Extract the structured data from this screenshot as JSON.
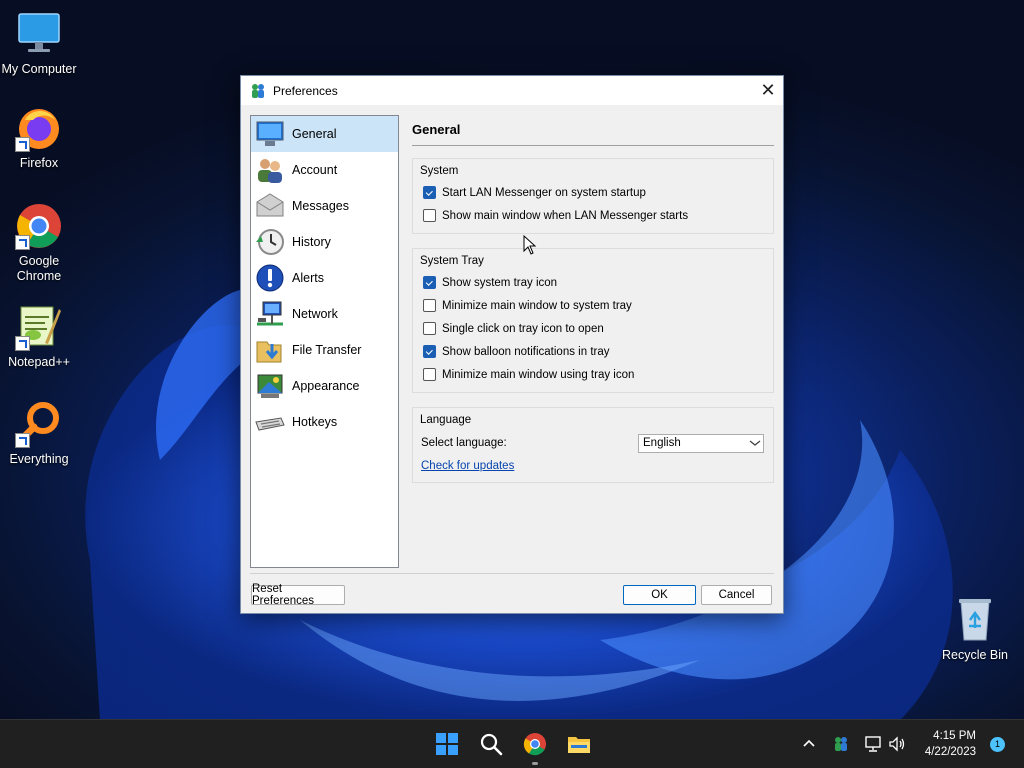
{
  "desktop": {
    "icons": [
      {
        "label": "My Computer",
        "icon": "monitor-icon"
      },
      {
        "label": "Firefox",
        "icon": "firefox-icon"
      },
      {
        "label": "Google Chrome",
        "icon": "chrome-icon"
      },
      {
        "label": "Notepad++",
        "icon": "notepadpp-icon"
      },
      {
        "label": "Everything",
        "icon": "search-magnifier-icon"
      },
      {
        "label": "Recycle Bin",
        "icon": "recycle-bin-icon"
      }
    ]
  },
  "dialog": {
    "title": "Preferences",
    "close_glyph": "✕",
    "nav": [
      {
        "label": "General",
        "icon": "monitor-icon",
        "selected": true
      },
      {
        "label": "Account",
        "icon": "users-icon"
      },
      {
        "label": "Messages",
        "icon": "envelope-icon"
      },
      {
        "label": "History",
        "icon": "clock-icon"
      },
      {
        "label": "Alerts",
        "icon": "exclamation-icon"
      },
      {
        "label": "Network",
        "icon": "network-icon"
      },
      {
        "label": "File Transfer",
        "icon": "folder-download-icon"
      },
      {
        "label": "Appearance",
        "icon": "palette-icon"
      },
      {
        "label": "Hotkeys",
        "icon": "keyboard-icon"
      }
    ],
    "panel_title": "General",
    "system": {
      "title": "System",
      "options": [
        {
          "label": "Start LAN Messenger on system startup",
          "checked": true
        },
        {
          "label": "Show main window when LAN Messenger starts",
          "checked": false
        }
      ]
    },
    "tray": {
      "title": "System Tray",
      "options": [
        {
          "label": "Show system tray icon",
          "checked": true
        },
        {
          "label": "Minimize main window to system tray",
          "checked": false
        },
        {
          "label": "Single click on tray icon to open",
          "checked": false
        },
        {
          "label": "Show balloon notifications in tray",
          "checked": true
        },
        {
          "label": "Minimize main window using tray icon",
          "checked": false
        }
      ]
    },
    "language": {
      "title": "Language",
      "select_label": "Select language:",
      "selected": "English",
      "updates_link": "Check for updates"
    },
    "buttons": {
      "reset": "Reset Preferences",
      "ok": "OK",
      "cancel": "Cancel"
    }
  },
  "taskbar": {
    "time": "4:15 PM",
    "date": "4/22/2023",
    "notification_count": "1",
    "tray_chevron": "^"
  }
}
